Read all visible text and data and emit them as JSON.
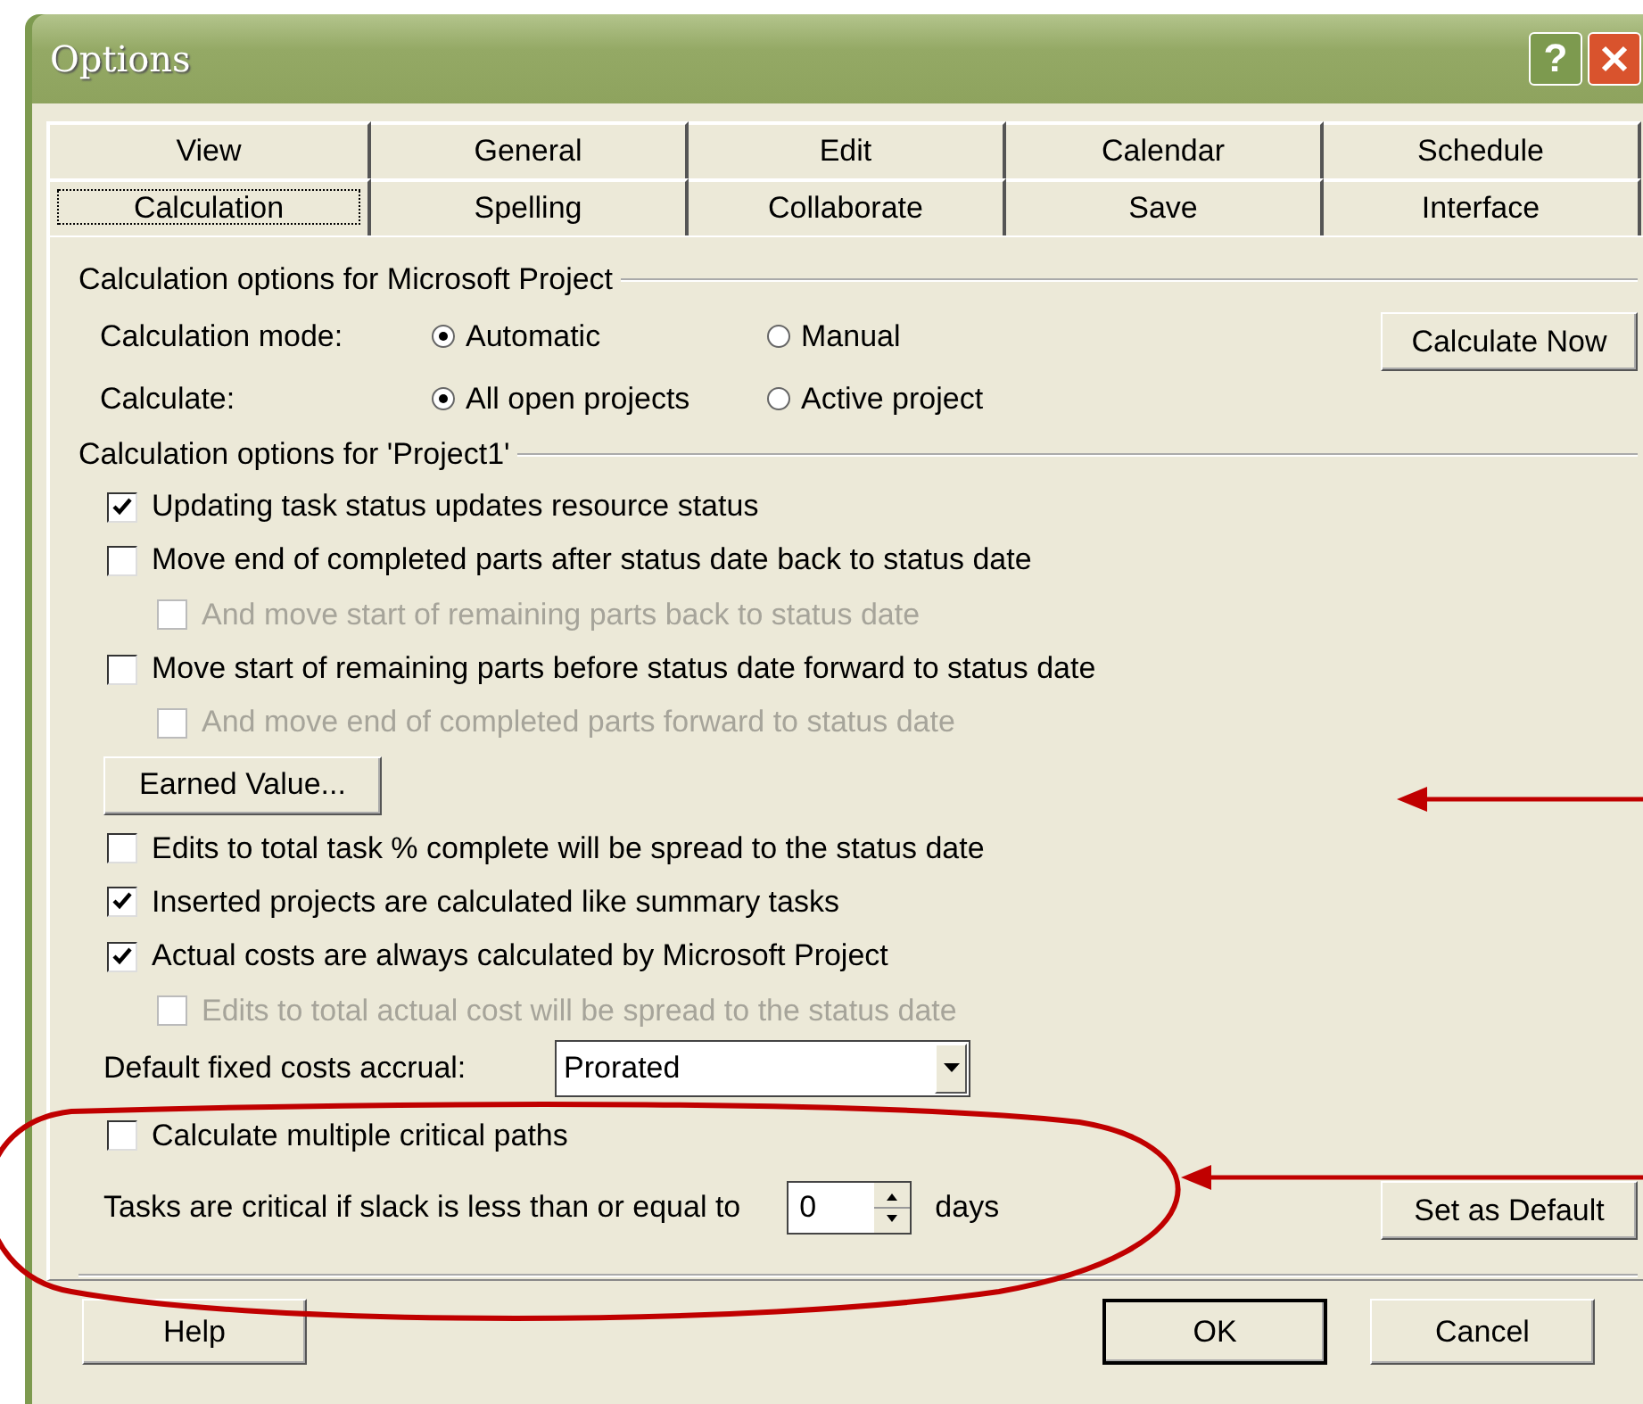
{
  "window": {
    "title": "Options",
    "help_button": "?"
  },
  "tab_rows": [
    [
      {
        "label": "View",
        "selected": false
      },
      {
        "label": "General",
        "selected": false
      },
      {
        "label": "Edit",
        "selected": false
      },
      {
        "label": "Calendar",
        "selected": false
      },
      {
        "label": "Schedule",
        "selected": false
      }
    ],
    [
      {
        "label": "Calculation",
        "selected": true
      },
      {
        "label": "Spelling",
        "selected": false
      },
      {
        "label": "Collaborate",
        "selected": false
      },
      {
        "label": "Save",
        "selected": false
      },
      {
        "label": "Interface",
        "selected": false
      }
    ]
  ],
  "app_group": {
    "title": "Calculation options for Microsoft Project",
    "button": "Calculate Now",
    "rows": [
      {
        "label": "Calculation mode:",
        "options": [
          {
            "label": "Automatic",
            "selected": true
          },
          {
            "label": "Manual",
            "selected": false
          }
        ]
      },
      {
        "label": "Calculate:",
        "options": [
          {
            "label": "All open projects",
            "selected": true
          },
          {
            "label": "Active project",
            "selected": false
          }
        ]
      }
    ]
  },
  "project_group": {
    "title": "Calculation options for 'Project1'",
    "items": [
      {
        "kind": "checkbox",
        "label": "Updating task status updates resource status",
        "checked": true,
        "disabled": false
      },
      {
        "kind": "checkbox",
        "label": "Move end of completed parts after status date back to status date",
        "checked": false,
        "disabled": false,
        "children": [
          {
            "kind": "checkbox",
            "label": "And move start of remaining parts back to status date",
            "checked": false,
            "disabled": true
          }
        ]
      },
      {
        "kind": "checkbox",
        "label": "Move start of remaining parts before status date forward to status date",
        "checked": false,
        "disabled": false,
        "children": [
          {
            "kind": "checkbox",
            "label": "And move end of completed parts forward to status date",
            "checked": false,
            "disabled": true
          }
        ]
      },
      {
        "kind": "button",
        "label": "Earned Value..."
      },
      {
        "kind": "checkbox",
        "label": "Edits to total task % complete will be spread to the status date",
        "checked": false,
        "disabled": false
      },
      {
        "kind": "checkbox",
        "label": "Inserted projects are calculated like summary tasks",
        "checked": true,
        "disabled": false
      },
      {
        "kind": "checkbox",
        "label": "Actual costs are always calculated by Microsoft Project",
        "checked": true,
        "disabled": false,
        "children": [
          {
            "kind": "checkbox",
            "label": "Edits to total actual cost will be spread to the status date",
            "checked": false,
            "disabled": true
          }
        ]
      },
      {
        "kind": "dropdown",
        "label": "Default fixed costs accrual:",
        "value": "Prorated"
      },
      {
        "kind": "checkbox",
        "label": "Calculate multiple critical paths",
        "checked": false,
        "disabled": false
      },
      {
        "kind": "spinner",
        "label": "Tasks are critical if slack is less than or equal to",
        "value": "0",
        "unit": "days",
        "button": "Set as Default"
      }
    ]
  },
  "footer": {
    "help": "Help",
    "buttons": [
      {
        "label": "OK",
        "default": true
      },
      {
        "label": "Cancel",
        "default": false
      }
    ]
  }
}
